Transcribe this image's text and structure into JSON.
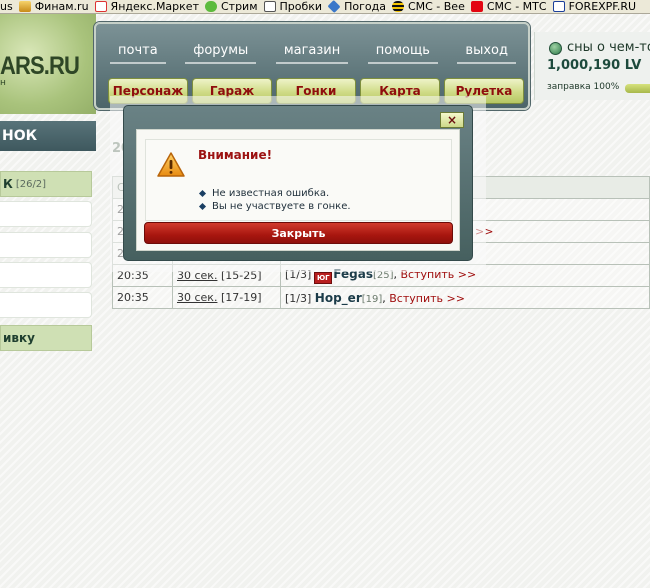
{
  "links_bar": {
    "items": [
      {
        "label": "us",
        "icon": "none"
      },
      {
        "label": "Финам.ru",
        "icon": "finam-icon"
      },
      {
        "label": "Яндекс.Маркет",
        "icon": "yandex-market-icon"
      },
      {
        "label": "Стрим",
        "icon": "strim-icon"
      },
      {
        "label": "Пробки",
        "icon": "probki-icon"
      },
      {
        "label": "Погода",
        "icon": "pogoda-icon"
      },
      {
        "label": "СМС - Bee",
        "icon": "beeline-icon"
      },
      {
        "label": "СМС - МТС",
        "icon": "mts-icon"
      },
      {
        "label": "FOREXPF.RU",
        "icon": "forex-icon"
      }
    ]
  },
  "logo": {
    "text": "ARS.RU",
    "subtext": "н"
  },
  "nav": {
    "top": [
      "почта",
      "форумы",
      "магазин",
      "помощь",
      "выход"
    ],
    "bottom": [
      "Персонаж",
      "Гараж",
      "Гонки",
      "Карта",
      "Рулетка"
    ]
  },
  "user": {
    "name": "сны о чем-то",
    "money": "1,000,190 LV",
    "fuel_label": "заправка 100%",
    "fuel_percent": 100
  },
  "sidebar": {
    "header": "НОК",
    "sub_label": "К",
    "sub_count": "[26/2]",
    "bottom_label": "ивку"
  },
  "race": {
    "title_visible": "20",
    "header_visible": "С",
    "rows": [
      {
        "time": "2",
        "duration": "",
        "level": "",
        "slots": "",
        "flag": "",
        "player": "",
        "player_level": "",
        "join": ""
      },
      {
        "time": "2",
        "duration": "",
        "level": "",
        "slots": "",
        "flag": "",
        "player": "",
        "player_level": "",
        "join": "ь >>"
      },
      {
        "time": "2",
        "duration": "",
        "level": "",
        "slots": "",
        "flag": "",
        "player": "",
        "player_level": "",
        "join": ""
      },
      {
        "time": "20:35",
        "duration": "30 сек.",
        "level": "[15-25]",
        "slots": "[1/3]",
        "flag": "ЮГ",
        "player": "Fegas",
        "player_level": "[25]",
        "join": "Вступить >>"
      },
      {
        "time": "20:35",
        "duration": "30 сек.",
        "level": "[17-19]",
        "slots": "[1/3]",
        "flag": "",
        "player": "Hop_er",
        "player_level": "[19]",
        "join": "Вступить >>"
      }
    ]
  },
  "modal": {
    "close_x": "×",
    "title": "Внимание!",
    "messages": [
      "Не известная ошибка.",
      "Вы не участвуете в гонке."
    ],
    "button": "Закрыть",
    "icon": "warning-icon"
  }
}
